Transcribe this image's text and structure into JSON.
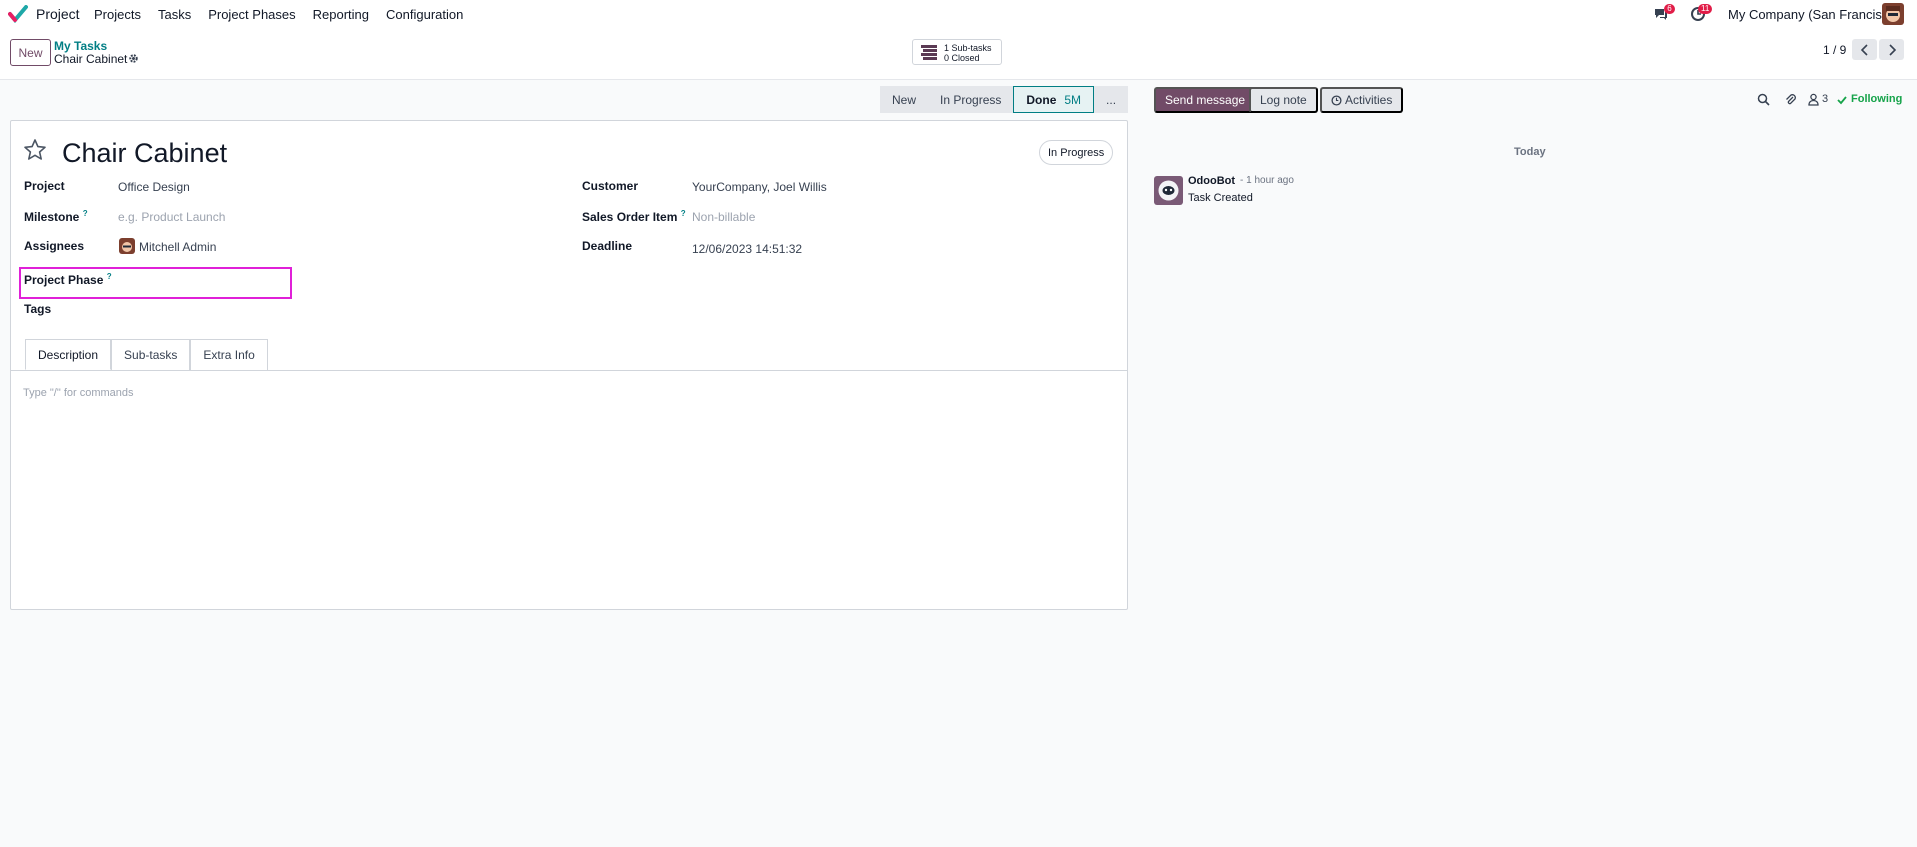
{
  "app": {
    "name": "Project",
    "logo_icon": "odoo-check-icon"
  },
  "nav": {
    "items": [
      "Projects",
      "Tasks",
      "Project Phases",
      "Reporting",
      "Configuration"
    ]
  },
  "systray": {
    "messages_badge": "6",
    "activities_badge": "11",
    "company": "My Company (San Francisco)"
  },
  "control": {
    "new_label": "New",
    "breadcrumb_parent": "My Tasks",
    "breadcrumb_current": "Chair Cabinet",
    "subtasks_line1": "1 Sub-tasks",
    "subtasks_line2": "0 Closed",
    "pager": "1 / 9"
  },
  "statusbar": {
    "stages": [
      "New",
      "In Progress",
      "Done",
      "..."
    ],
    "active": "Done",
    "active_duration": "5M"
  },
  "form": {
    "title": "Chair Cabinet",
    "state": "In Progress",
    "fields": {
      "project_label": "Project",
      "project_value": "Office Design",
      "milestone_label": "Milestone",
      "milestone_placeholder": "e.g. Product Launch",
      "assignees_label": "Assignees",
      "assignees_value": "Mitchell Admin",
      "phase_label": "Project Phase",
      "tags_label": "Tags",
      "customer_label": "Customer",
      "customer_value": "YourCompany, Joel Willis",
      "soi_label": "Sales Order Item",
      "soi_placeholder": "Non-billable",
      "deadline_label": "Deadline",
      "deadline_value": "12/06/2023 14:51:32"
    },
    "help_mark": "?",
    "tabs": [
      "Description",
      "Sub-tasks",
      "Extra Info"
    ],
    "description_placeholder": "Type \"/\" for commands"
  },
  "chatter": {
    "send_label": "Send message",
    "log_label": "Log note",
    "activities_label": "Activities",
    "followers_count": "3",
    "following_label": "Following",
    "date_separator": "Today",
    "message": {
      "author": "OdooBot",
      "time": "- 1 hour ago",
      "body": "Task Created"
    }
  },
  "colors": {
    "brand": "#714b67",
    "accent": "#017e84",
    "highlight": "#e020d8",
    "following": "#16a34a"
  }
}
